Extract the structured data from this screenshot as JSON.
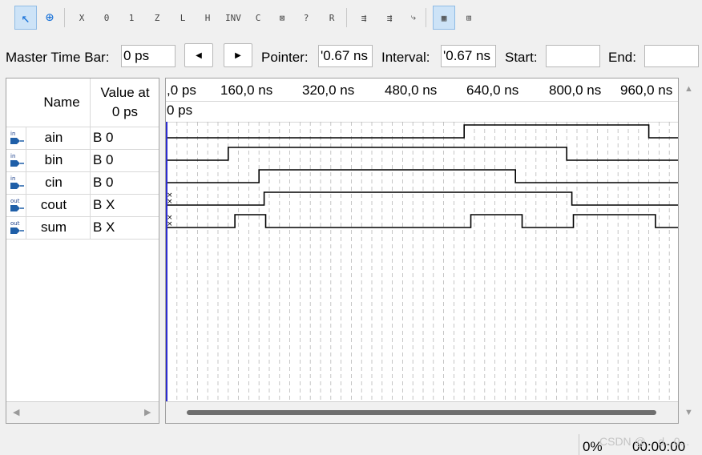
{
  "toolbar": {
    "tools": [
      {
        "name": "selection-tool-icon",
        "glyph": "↖",
        "active": true
      },
      {
        "name": "zoom-tool-icon",
        "glyph": "⊕",
        "active": false
      },
      {
        "name": "uninitialized-value-icon",
        "glyph": "X",
        "active": false
      },
      {
        "name": "forcing-low-icon",
        "glyph": "0",
        "active": false
      },
      {
        "name": "forcing-high-icon",
        "glyph": "1",
        "active": false
      },
      {
        "name": "high-impedance-icon",
        "glyph": "Z",
        "active": false
      },
      {
        "name": "weak-low-icon",
        "glyph": "L",
        "active": false
      },
      {
        "name": "weak-high-icon",
        "glyph": "H",
        "active": false
      },
      {
        "name": "invert-icon",
        "glyph": "INV",
        "active": false
      },
      {
        "name": "count-value-icon",
        "glyph": "C",
        "active": false
      },
      {
        "name": "clock-icon",
        "glyph": "⊠",
        "active": false
      },
      {
        "name": "arbitrary-value-icon",
        "glyph": "?",
        "active": false
      },
      {
        "name": "random-value-icon",
        "glyph": "R",
        "active": false
      },
      {
        "name": "run-functional-simulation-icon",
        "glyph": "⇶",
        "active": false
      },
      {
        "name": "run-timing-simulation-icon",
        "glyph": "⇶",
        "active": false
      },
      {
        "name": "generate-netlist-icon",
        "glyph": "⤷",
        "active": false
      },
      {
        "name": "snap-to-grid-icon",
        "glyph": "▦",
        "active": true
      },
      {
        "name": "grid-icon",
        "glyph": "⊞",
        "active": false
      }
    ]
  },
  "timebar": {
    "master_label": "Master Time Bar:",
    "master_value": "0 ps",
    "pointer_label": "Pointer:",
    "pointer_value": "'0.67 ns",
    "interval_label": "Interval:",
    "interval_value": "'0.67 ns",
    "start_label": "Start:",
    "start_value": "",
    "end_label": "End:",
    "end_value": ""
  },
  "columns": {
    "name": "Name",
    "value_line1": "Value at",
    "value_line2": "0 ps"
  },
  "signals": [
    {
      "name": "ain",
      "direction": "in",
      "value": "B 0"
    },
    {
      "name": "bin",
      "direction": "in",
      "value": "B 0"
    },
    {
      "name": "cin",
      "direction": "in",
      "value": "B 0"
    },
    {
      "name": "cout",
      "direction": "out",
      "value": "B X"
    },
    {
      "name": "sum",
      "direction": "out",
      "value": "B X"
    }
  ],
  "ruler": {
    "ticks": [
      ",0 ps",
      "160,0 ns",
      "320,0 ns",
      "480,0 ns",
      "640,0 ns",
      "800,0 ns",
      "960,0 ns"
    ],
    "cursor_label": "0 ps"
  },
  "waveforms": {
    "ain": {
      "initial": "0",
      "transitions": [
        {
          "t": 580,
          "v": 1
        },
        {
          "t": 940,
          "v": 0
        }
      ]
    },
    "bin": {
      "initial": "0",
      "transitions": [
        {
          "t": 120,
          "v": 1
        },
        {
          "t": 780,
          "v": 0
        }
      ]
    },
    "cin": {
      "initial": "0",
      "transitions": [
        {
          "t": 180,
          "v": 1
        },
        {
          "t": 680,
          "v": 0
        }
      ]
    },
    "cout": {
      "initial": "X",
      "transitions": [
        {
          "t": 0,
          "v": 0
        },
        {
          "t": 190,
          "v": 1
        },
        {
          "t": 790,
          "v": 0
        }
      ]
    },
    "sum": {
      "initial": "X",
      "transitions": [
        {
          "t": 0,
          "v": 0
        },
        {
          "t": 133,
          "v": 1
        },
        {
          "t": 193,
          "v": 0
        },
        {
          "t": 593,
          "v": 1
        },
        {
          "t": 693,
          "v": 0
        },
        {
          "t": 793,
          "v": 1
        },
        {
          "t": 953,
          "v": 0
        }
      ]
    }
  },
  "status": {
    "progress": "0%",
    "elapsed": "00:00:00",
    "watermark": "CSDN @ ...d...0..."
  },
  "colors": {
    "pin_input": "#1f5fa8",
    "pin_output": "#1f5fa8",
    "master_bar": "#2b2bd0",
    "active_tool_bg": "#cde3f7",
    "grid_line": "#b8b8b8"
  }
}
